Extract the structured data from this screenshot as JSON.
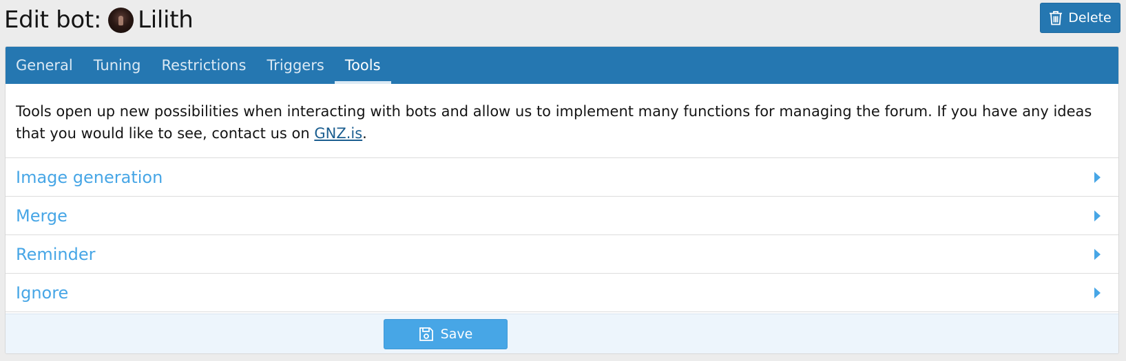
{
  "header": {
    "title_prefix": "Edit bot:",
    "bot_name": "Lilith",
    "avatar_icon": "bot-avatar",
    "delete_label": "Delete",
    "delete_icon": "trash-icon"
  },
  "tabs": [
    {
      "label": "General",
      "active": false
    },
    {
      "label": "Tuning",
      "active": false
    },
    {
      "label": "Restrictions",
      "active": false
    },
    {
      "label": "Triggers",
      "active": false
    },
    {
      "label": "Tools",
      "active": true
    }
  ],
  "intro": {
    "text_before_link": "Tools open up new possibilities when interacting with bots and allow us to implement many functions for managing the forum. If you have any ideas that you would like to see, contact us on ",
    "link_text": "GNZ.is",
    "text_after_link": "."
  },
  "tools": [
    {
      "label": "Image generation",
      "icon": "caret-right-icon"
    },
    {
      "label": "Merge",
      "icon": "caret-right-icon"
    },
    {
      "label": "Reminder",
      "icon": "caret-right-icon"
    },
    {
      "label": "Ignore",
      "icon": "caret-right-icon"
    }
  ],
  "footer": {
    "save_label": "Save",
    "save_icon": "save-icon"
  },
  "colors": {
    "tab_bar": "#2577b1",
    "accent": "#47a6e6",
    "page_background": "#ececec",
    "footer_background": "#edf5fc"
  }
}
